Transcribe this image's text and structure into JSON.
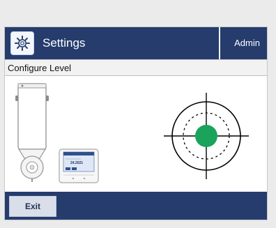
{
  "header": {
    "title": "Settings",
    "user": "Admin",
    "settings_icon": "gear-icon"
  },
  "subheader": {
    "title": "Configure Level"
  },
  "illustration": {
    "terminal_display_value": "24.2021"
  },
  "level_indicator": {
    "bubble_color": "#1aa35a",
    "line_color": "#000000"
  },
  "footer": {
    "exit_label": "Exit"
  },
  "colors": {
    "bar_background": "#253c6d"
  }
}
